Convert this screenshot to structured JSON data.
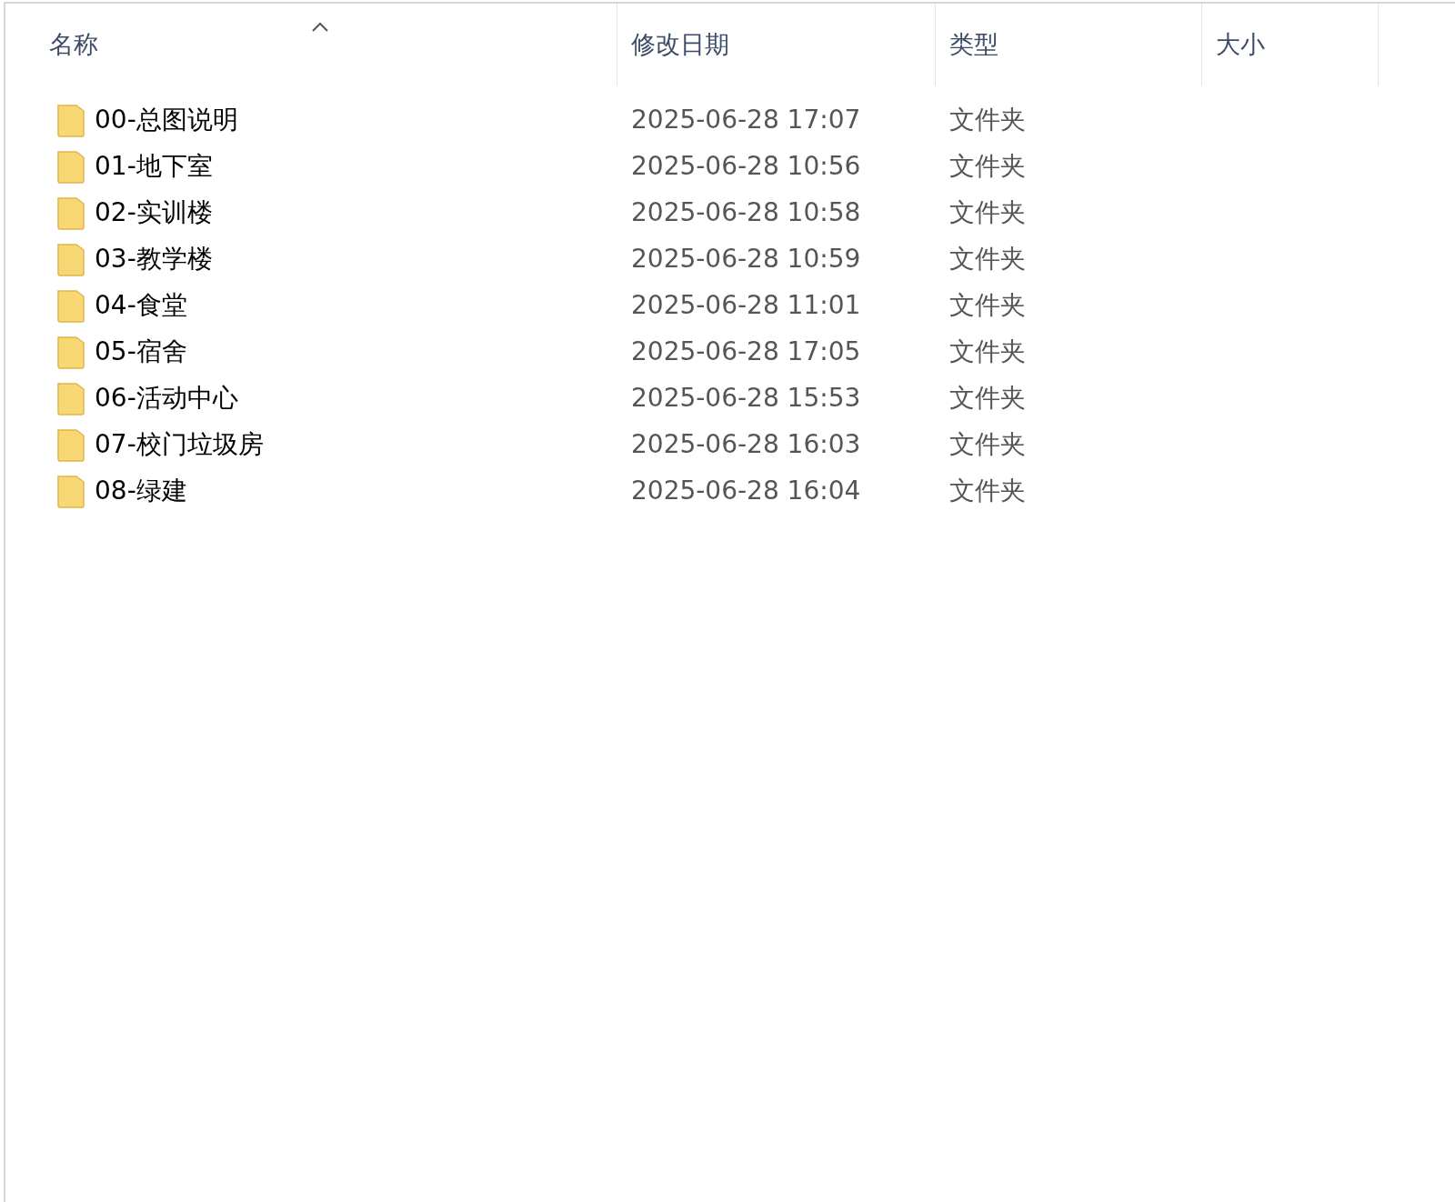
{
  "columns": [
    {
      "label": "名称",
      "sorted": true
    },
    {
      "label": "修改日期",
      "sorted": false
    },
    {
      "label": "类型",
      "sorted": false
    },
    {
      "label": "大小",
      "sorted": false
    }
  ],
  "rows": [
    {
      "name": "00-总图说明",
      "date": "2025-06-28 17:07",
      "type": "文件夹"
    },
    {
      "name": "01-地下室",
      "date": "2025-06-28 10:56",
      "type": "文件夹"
    },
    {
      "name": "02-实训楼",
      "date": "2025-06-28 10:58",
      "type": "文件夹"
    },
    {
      "name": "03-教学楼",
      "date": "2025-06-28 10:59",
      "type": "文件夹"
    },
    {
      "name": "04-食堂",
      "date": "2025-06-28 11:01",
      "type": "文件夹"
    },
    {
      "name": "05-宿舍",
      "date": "2025-06-28 17:05",
      "type": "文件夹"
    },
    {
      "name": "06-活动中心",
      "date": "2025-06-28 15:53",
      "type": "文件夹"
    },
    {
      "name": "07-校门垃圾房",
      "date": "2025-06-28 16:03",
      "type": "文件夹"
    },
    {
      "name": "08-绿建",
      "date": "2025-06-28 16:04",
      "type": "文件夹"
    }
  ]
}
